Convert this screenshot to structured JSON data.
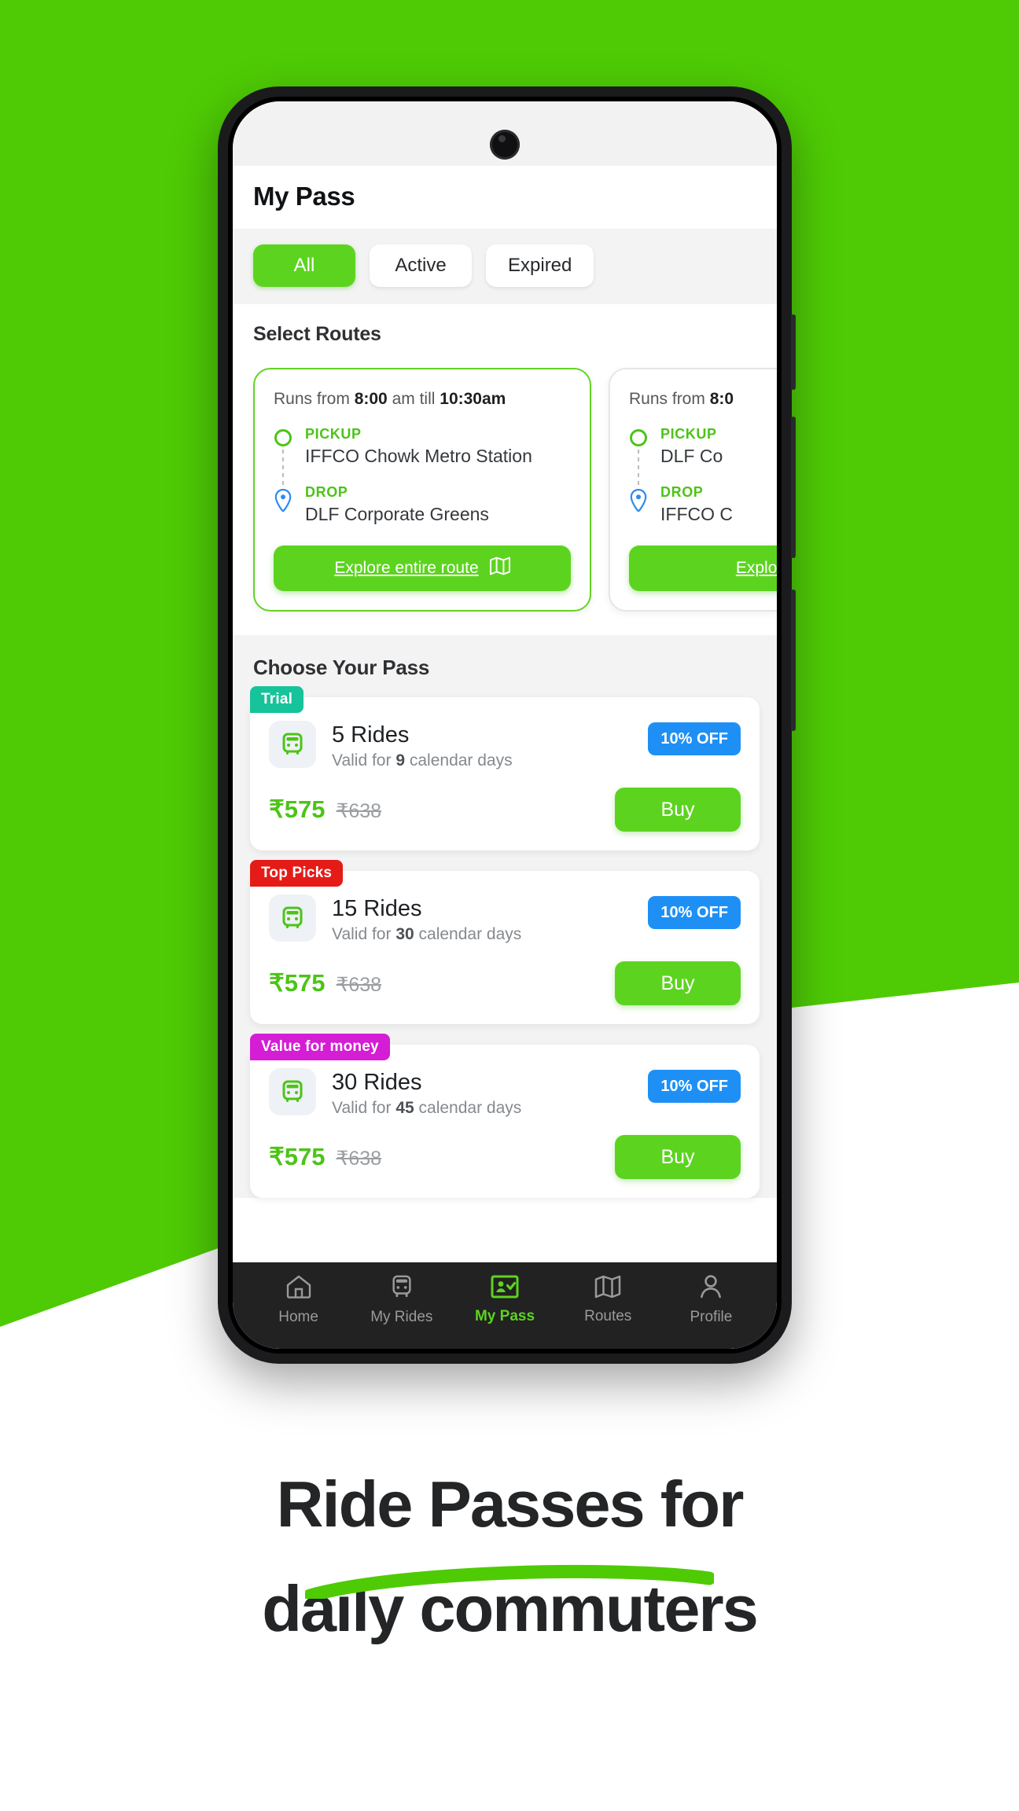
{
  "theme": {
    "brand_green": "#4ECB05",
    "button_green": "#5CD41F",
    "accent_blue": "#1E90F5",
    "teal": "#17C39A",
    "red": "#E41B17",
    "magenta": "#D41DD4",
    "dark": "#222222"
  },
  "app": {
    "title": "My Pass",
    "filters": [
      {
        "label": "All",
        "active": true
      },
      {
        "label": "Active",
        "active": false
      },
      {
        "label": "Expired",
        "active": false
      }
    ],
    "routes": {
      "section_title": "Select Routes",
      "cards": [
        {
          "runs_prefix": "Runs from",
          "runs_start": "8:00",
          "runs_mid": "am till",
          "runs_end": "10:30am",
          "pickup_label": "PICKUP",
          "pickup_name": "IFFCO Chowk Metro Station",
          "drop_label": "DROP",
          "drop_name": "DLF Corporate Greens",
          "explore_label": "Explore entire route",
          "explore_icon": "map-icon",
          "selected": true
        },
        {
          "runs_prefix": "Runs from",
          "runs_start": "8:0",
          "runs_mid": "",
          "runs_end": "",
          "pickup_label": "PICKUP",
          "pickup_name": "DLF Co",
          "drop_label": "DROP",
          "drop_name": "IFFCO C",
          "explore_label": "Explore ent",
          "explore_icon": "map-icon",
          "selected": false
        }
      ]
    },
    "passes": {
      "section_title": "Choose Your Pass",
      "items": [
        {
          "badge": "Trial",
          "badge_color": "#17C39A",
          "icon": "bus-icon",
          "rides": "5 Rides",
          "valid_prefix": "Valid for",
          "valid_days": "9",
          "valid_suffix": "calendar days",
          "discount": "10% OFF",
          "price_new": "₹575",
          "price_old": "₹638",
          "buy_label": "Buy"
        },
        {
          "badge": "Top Picks",
          "badge_color": "#E41B17",
          "icon": "bus-icon",
          "rides": "15 Rides",
          "valid_prefix": "Valid for",
          "valid_days": "30",
          "valid_suffix": "calendar days",
          "discount": "10% OFF",
          "price_new": "₹575",
          "price_old": "₹638",
          "buy_label": "Buy"
        },
        {
          "badge": "Value for money",
          "badge_color": "#D41DD4",
          "icon": "bus-icon",
          "rides": "30 Rides",
          "valid_prefix": "Valid for",
          "valid_days": "45",
          "valid_suffix": "calendar days",
          "discount": "10% OFF",
          "price_new": "₹575",
          "price_old": "₹638",
          "buy_label": "Buy"
        }
      ]
    },
    "bottom_nav": [
      {
        "label": "Home",
        "icon": "home-icon",
        "active": false
      },
      {
        "label": "My Rides",
        "icon": "bus-icon",
        "active": false
      },
      {
        "label": "My Pass",
        "icon": "pass-card-icon",
        "active": true
      },
      {
        "label": "Routes",
        "icon": "map-icon",
        "active": false
      },
      {
        "label": "Profile",
        "icon": "person-icon",
        "active": false
      }
    ]
  },
  "caption": {
    "line1": "Ride Passes for",
    "line2": "daily commuters"
  }
}
